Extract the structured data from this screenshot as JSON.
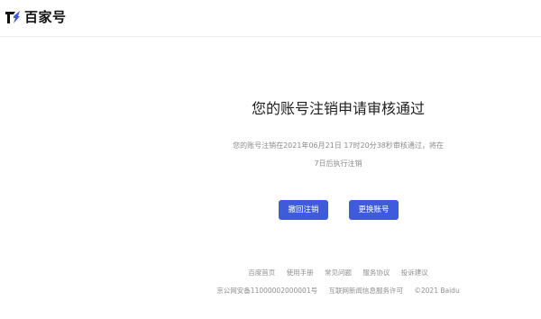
{
  "header": {
    "logo_text": "百家号"
  },
  "main": {
    "title": "您的账号注销申请审核通过",
    "desc_line1": "您的账号注销在2021年06月21日 17时20分38秒审核通过，将在",
    "desc_line2": "7日后执行注销",
    "revoke_label": "撤回注销",
    "change_label": "更换账号"
  },
  "footer": {
    "links": [
      "百度首页",
      "使用手册",
      "常见问题",
      "服务协议",
      "投诉建议"
    ],
    "icp": "京公网安备11000002000001号",
    "news_license": "互联网新闻信息服务许可",
    "copyright": "©2021 Baidu"
  },
  "colors": {
    "accent": "#3d5bdb",
    "footer_text": "#8f8f8f",
    "desc_text": "#8a8a8a"
  }
}
